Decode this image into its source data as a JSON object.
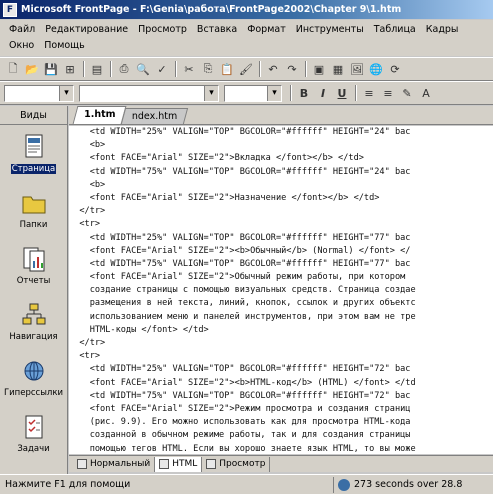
{
  "window": {
    "title": "Microsoft FrontPage - F:\\Genia\\работа\\FrontPage2002\\Chapter 9\\1.htm"
  },
  "menu": [
    "Файл",
    "Редактирование",
    "Просмотр",
    "Вставка",
    "Формат",
    "Инструменты",
    "Таблица",
    "Кадры",
    "Окно",
    "Помощь"
  ],
  "views": {
    "header": "Виды",
    "items": [
      "Страница",
      "Папки",
      "Отчеты",
      "Навигация",
      "Гиперссылки",
      "Задачи"
    ]
  },
  "doc_tabs": [
    "1.htm",
    "ndex.htm"
  ],
  "code": [
    "    <td WIDTH=\"25%\" VALIGN=\"TOP\" BGCOLOR=\"#ffffff\" HEIGHT=\"24\" bac",
    "    <b>",
    "    <font FACE=\"Arial\" SIZE=\"2\">Вкладка </font></b> </td>",
    "    <td WIDTH=\"75%\" VALIGN=\"TOP\" BGCOLOR=\"#ffffff\" HEIGHT=\"24\" bac",
    "    <b>",
    "    <font FACE=\"Arial\" SIZE=\"2\">Назначение </font></b> </td>",
    "  </tr>",
    "  <tr>",
    "    <td WIDTH=\"25%\" VALIGN=\"TOP\" BGCOLOR=\"#ffffff\" HEIGHT=\"77\" bac",
    "    <font FACE=\"Arial\" SIZE=\"2\"><b>Обычный</b> (Normal) </font> </",
    "    <td WIDTH=\"75%\" VALIGN=\"TOP\" BGCOLOR=\"#ffffff\" HEIGHT=\"77\" bac",
    "    <font FACE=\"Arial\" SIZE=\"2\">Обычный режим работы, при котором",
    "    создание страницы с помощью визуальных средств. Страница создае",
    "    размещения в ней текста, линий, кнопок, ссылок и других объектс",
    "    использованием меню и панелей инструментов, при этом вам не тре",
    "    HTML-коды </font> </td>",
    "  </tr>",
    "  <tr>",
    "    <td WIDTH=\"25%\" VALIGN=\"TOP\" BGCOLOR=\"#ffffff\" HEIGHT=\"72\" bac",
    "    <font FACE=\"Arial\" SIZE=\"2\"><b>HTML-код</b> (HTML) </font> </td",
    "    <td WIDTH=\"75%\" VALIGN=\"TOP\" BGCOLOR=\"#ffffff\" HEIGHT=\"72\" bac",
    "    <font FACE=\"Arial\" SIZE=\"2\">Режим просмотра и создания страниц",
    "    (рис. 9.9). Его можно использовать как для просмотра HTML-кода",
    "    созданной в обычном режиме работы, так и для создания страницы",
    "    помощью тегов HTML. Если вы хорошо знаете язык HTML, то вы може"
  ],
  "view_tabs": [
    "Нормальный",
    "HTML",
    "Просмотр"
  ],
  "status": {
    "text": "Нажмите F1 для помощи",
    "right": "273 seconds over 28.8"
  }
}
